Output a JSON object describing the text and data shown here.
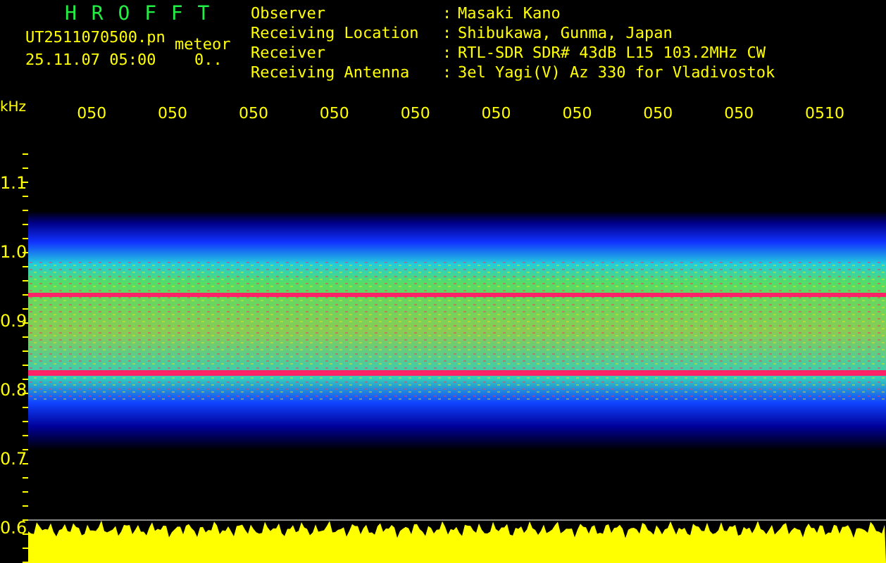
{
  "app_title": "H R O F F T",
  "file": {
    "name": "UT2511070500.pn",
    "tag": "meteor",
    "datetime": "25.11.07 05:00",
    "count": "0.."
  },
  "station": [
    {
      "label": "Observer",
      "separator": ":",
      "value": "Masaki Kano"
    },
    {
      "label": "Receiving Location",
      "separator": ":",
      "value": "Shibukawa, Gunma, Japan"
    },
    {
      "label": "Receiver",
      "separator": ":",
      "value": "RTL-SDR SDR# 43dB L15 103.2MHz CW"
    },
    {
      "label": "Receiving Antenna",
      "separator": ":",
      "value": "3el Yagi(V) Az 330 for Vladivostok"
    }
  ],
  "frequency_axis": {
    "unit": "kHz",
    "ticks": [
      "1.1",
      "1.0",
      "0.9",
      "0.8",
      "0.7",
      "0.6"
    ]
  },
  "time_axis": {
    "ticks": [
      "050",
      "050",
      "050",
      "050",
      "050",
      "050",
      "050",
      "050",
      "050",
      "0510"
    ]
  }
}
